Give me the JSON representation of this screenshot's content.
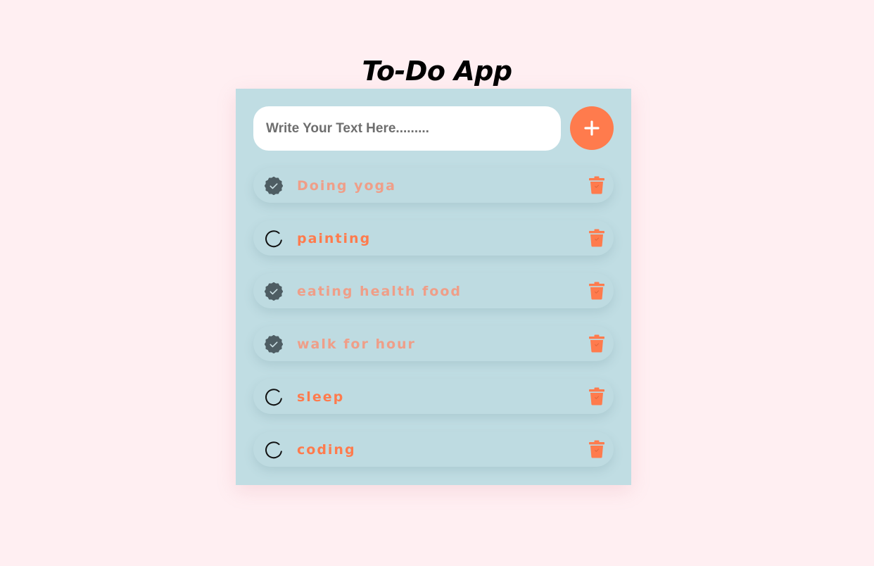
{
  "app": {
    "title": "To-Do App"
  },
  "input": {
    "placeholder": "Write Your Text Here.........",
    "value": ""
  },
  "add_button": {
    "icon": "plus-icon"
  },
  "tasks": [
    {
      "label": "Doing yoga",
      "done": true
    },
    {
      "label": "painting",
      "done": false
    },
    {
      "label": "eating health food",
      "done": true
    },
    {
      "label": "walk for hour",
      "done": true
    },
    {
      "label": "sleep",
      "done": false
    },
    {
      "label": "coding",
      "done": false
    }
  ],
  "icons": {
    "done": "checked-badge-icon",
    "pending": "circle-icon",
    "delete": "trash-icon"
  },
  "colors": {
    "background": "#ffeff2",
    "panel": "#c0dde3",
    "accent": "#ff7b4d",
    "done_text": "#ef9e88",
    "checked_badge": "#4e5d63"
  }
}
